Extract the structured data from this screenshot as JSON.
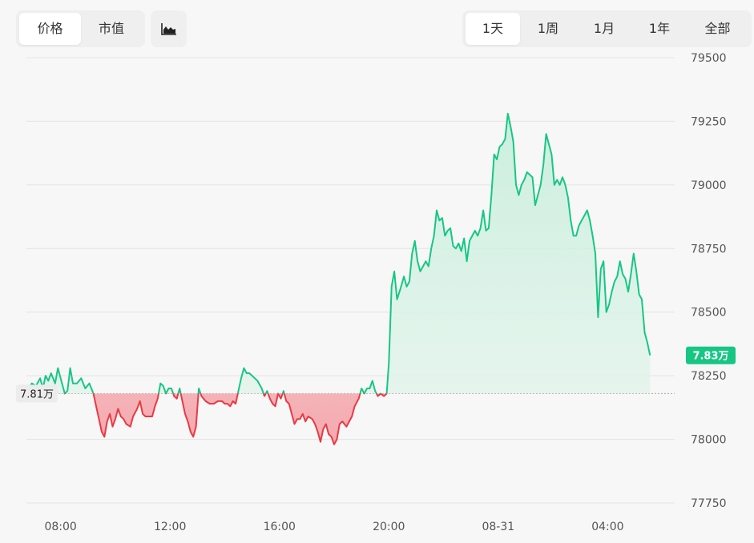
{
  "toolbar": {
    "metric_tabs": [
      {
        "label": "价格",
        "active": true
      },
      {
        "label": "市值",
        "active": false
      }
    ],
    "chart_type_icon": "area-chart-icon",
    "range_tabs": [
      {
        "label": "1天",
        "active": true
      },
      {
        "label": "1周",
        "active": false
      },
      {
        "label": "1月",
        "active": false
      },
      {
        "label": "1年",
        "active": false
      },
      {
        "label": "全部",
        "active": false
      }
    ]
  },
  "colors": {
    "up": "#16c784",
    "down": "#ea3943",
    "up_fill": "#d7f2e5",
    "down_fill": "#f6b9bd",
    "grid": "#e4e4e4"
  },
  "chart_data": {
    "type": "area",
    "y_ticks": [
      79500,
      79250,
      79000,
      78750,
      78500,
      78250,
      78000,
      77750
    ],
    "ylim": [
      77750,
      79500
    ],
    "x_ticks": [
      {
        "label": "08:00",
        "hour": 8
      },
      {
        "label": "12:00",
        "hour": 12
      },
      {
        "label": "16:00",
        "hour": 16
      },
      {
        "label": "20:00",
        "hour": 20
      },
      {
        "label": "08-31",
        "hour": 24
      },
      {
        "label": "04:00",
        "hour": 28
      }
    ],
    "xlim_hours": [
      6.75,
      30.45
    ],
    "baseline": {
      "value": 78180,
      "label": "7.81万"
    },
    "current": {
      "value": 78330,
      "label": "7.83万"
    },
    "series": [
      {
        "values": [
          [
            6.82,
            78200
          ],
          [
            6.95,
            78220
          ],
          [
            7.1,
            78210
          ],
          [
            7.25,
            78240
          ],
          [
            7.35,
            78200
          ],
          [
            7.45,
            78250
          ],
          [
            7.55,
            78230
          ],
          [
            7.65,
            78260
          ],
          [
            7.8,
            78220
          ],
          [
            7.9,
            78280
          ],
          [
            8.05,
            78220
          ],
          [
            8.15,
            78180
          ],
          [
            8.25,
            78190
          ],
          [
            8.35,
            78280
          ],
          [
            8.45,
            78220
          ],
          [
            8.6,
            78220
          ],
          [
            8.75,
            78240
          ],
          [
            8.9,
            78200
          ],
          [
            9.05,
            78220
          ],
          [
            9.2,
            78180
          ],
          [
            9.3,
            78130
          ],
          [
            9.4,
            78080
          ],
          [
            9.5,
            78030
          ],
          [
            9.6,
            78010
          ],
          [
            9.7,
            78070
          ],
          [
            9.8,
            78100
          ],
          [
            9.9,
            78050
          ],
          [
            10.0,
            78080
          ],
          [
            10.1,
            78120
          ],
          [
            10.2,
            78090
          ],
          [
            10.3,
            78080
          ],
          [
            10.4,
            78060
          ],
          [
            10.55,
            78050
          ],
          [
            10.65,
            78090
          ],
          [
            10.8,
            78120
          ],
          [
            10.9,
            78150
          ],
          [
            11.0,
            78100
          ],
          [
            11.1,
            78090
          ],
          [
            11.25,
            78090
          ],
          [
            11.35,
            78090
          ],
          [
            11.45,
            78130
          ],
          [
            11.55,
            78160
          ],
          [
            11.65,
            78220
          ],
          [
            11.75,
            78210
          ],
          [
            11.85,
            78180
          ],
          [
            11.95,
            78200
          ],
          [
            12.05,
            78200
          ],
          [
            12.15,
            78170
          ],
          [
            12.25,
            78160
          ],
          [
            12.35,
            78200
          ],
          [
            12.45,
            78150
          ],
          [
            12.55,
            78100
          ],
          [
            12.65,
            78070
          ],
          [
            12.75,
            78030
          ],
          [
            12.85,
            78010
          ],
          [
            12.95,
            78050
          ],
          [
            13.05,
            78200
          ],
          [
            13.15,
            78170
          ],
          [
            13.3,
            78150
          ],
          [
            13.45,
            78140
          ],
          [
            13.6,
            78140
          ],
          [
            13.75,
            78150
          ],
          [
            13.9,
            78150
          ],
          [
            14.0,
            78140
          ],
          [
            14.1,
            78140
          ],
          [
            14.2,
            78130
          ],
          [
            14.3,
            78150
          ],
          [
            14.4,
            78140
          ],
          [
            14.5,
            78190
          ],
          [
            14.6,
            78240
          ],
          [
            14.7,
            78280
          ],
          [
            14.8,
            78260
          ],
          [
            14.9,
            78260
          ],
          [
            15.0,
            78250
          ],
          [
            15.1,
            78240
          ],
          [
            15.2,
            78230
          ],
          [
            15.35,
            78200
          ],
          [
            15.45,
            78170
          ],
          [
            15.55,
            78190
          ],
          [
            15.65,
            78160
          ],
          [
            15.75,
            78140
          ],
          [
            15.85,
            78130
          ],
          [
            15.95,
            78180
          ],
          [
            16.05,
            78160
          ],
          [
            16.15,
            78190
          ],
          [
            16.25,
            78150
          ],
          [
            16.35,
            78140
          ],
          [
            16.45,
            78100
          ],
          [
            16.55,
            78060
          ],
          [
            16.65,
            78080
          ],
          [
            16.75,
            78080
          ],
          [
            16.85,
            78100
          ],
          [
            16.95,
            78070
          ],
          [
            17.05,
            78090
          ],
          [
            17.2,
            78080
          ],
          [
            17.3,
            78060
          ],
          [
            17.4,
            78030
          ],
          [
            17.5,
            77990
          ],
          [
            17.6,
            78040
          ],
          [
            17.7,
            78060
          ],
          [
            17.8,
            78020
          ],
          [
            17.9,
            78010
          ],
          [
            18.0,
            77980
          ],
          [
            18.1,
            78000
          ],
          [
            18.2,
            78060
          ],
          [
            18.3,
            78070
          ],
          [
            18.45,
            78050
          ],
          [
            18.55,
            78070
          ],
          [
            18.65,
            78090
          ],
          [
            18.75,
            78130
          ],
          [
            18.9,
            78160
          ],
          [
            19.0,
            78200
          ],
          [
            19.1,
            78180
          ],
          [
            19.2,
            78200
          ],
          [
            19.3,
            78200
          ],
          [
            19.4,
            78230
          ],
          [
            19.5,
            78190
          ],
          [
            19.6,
            78170
          ],
          [
            19.7,
            78180
          ],
          [
            19.82,
            78170
          ],
          [
            19.92,
            78180
          ],
          [
            20.0,
            78300
          ],
          [
            20.1,
            78600
          ],
          [
            20.2,
            78660
          ],
          [
            20.3,
            78550
          ],
          [
            20.42,
            78590
          ],
          [
            20.55,
            78640
          ],
          [
            20.65,
            78600
          ],
          [
            20.75,
            78620
          ],
          [
            20.85,
            78730
          ],
          [
            20.95,
            78780
          ],
          [
            21.05,
            78700
          ],
          [
            21.15,
            78660
          ],
          [
            21.25,
            78680
          ],
          [
            21.35,
            78700
          ],
          [
            21.45,
            78680
          ],
          [
            21.55,
            78750
          ],
          [
            21.65,
            78800
          ],
          [
            21.75,
            78900
          ],
          [
            21.85,
            78860
          ],
          [
            21.95,
            78870
          ],
          [
            22.05,
            78800
          ],
          [
            22.15,
            78820
          ],
          [
            22.25,
            78830
          ],
          [
            22.35,
            78760
          ],
          [
            22.45,
            78750
          ],
          [
            22.55,
            78770
          ],
          [
            22.65,
            78740
          ],
          [
            22.75,
            78790
          ],
          [
            22.85,
            78700
          ],
          [
            22.95,
            78780
          ],
          [
            23.05,
            78800
          ],
          [
            23.15,
            78820
          ],
          [
            23.25,
            78800
          ],
          [
            23.35,
            78830
          ],
          [
            23.45,
            78900
          ],
          [
            23.55,
            78820
          ],
          [
            23.65,
            78830
          ],
          [
            23.75,
            78960
          ],
          [
            23.85,
            79120
          ],
          [
            23.95,
            79100
          ],
          [
            24.05,
            79150
          ],
          [
            24.15,
            79160
          ],
          [
            24.25,
            79180
          ],
          [
            24.35,
            79280
          ],
          [
            24.45,
            79230
          ],
          [
            24.55,
            79170
          ],
          [
            24.65,
            79000
          ],
          [
            24.75,
            78960
          ],
          [
            24.85,
            79000
          ],
          [
            24.95,
            79020
          ],
          [
            25.05,
            79050
          ],
          [
            25.15,
            79040
          ],
          [
            25.25,
            79030
          ],
          [
            25.35,
            78920
          ],
          [
            25.45,
            78960
          ],
          [
            25.55,
            79000
          ],
          [
            25.65,
            79080
          ],
          [
            25.75,
            79200
          ],
          [
            25.85,
            79160
          ],
          [
            25.95,
            79120
          ],
          [
            26.05,
            79000
          ],
          [
            26.15,
            79020
          ],
          [
            26.25,
            79000
          ],
          [
            26.35,
            79030
          ],
          [
            26.45,
            79000
          ],
          [
            26.55,
            78950
          ],
          [
            26.65,
            78860
          ],
          [
            26.75,
            78800
          ],
          [
            26.85,
            78800
          ],
          [
            26.95,
            78840
          ],
          [
            27.05,
            78860
          ],
          [
            27.15,
            78880
          ],
          [
            27.25,
            78900
          ],
          [
            27.35,
            78860
          ],
          [
            27.45,
            78800
          ],
          [
            27.55,
            78730
          ],
          [
            27.65,
            78480
          ],
          [
            27.75,
            78670
          ],
          [
            27.85,
            78700
          ],
          [
            27.95,
            78500
          ],
          [
            28.05,
            78530
          ],
          [
            28.15,
            78580
          ],
          [
            28.25,
            78620
          ],
          [
            28.35,
            78640
          ],
          [
            28.45,
            78700
          ],
          [
            28.55,
            78650
          ],
          [
            28.65,
            78630
          ],
          [
            28.75,
            78580
          ],
          [
            28.85,
            78650
          ],
          [
            28.95,
            78730
          ],
          [
            29.05,
            78660
          ],
          [
            29.15,
            78570
          ],
          [
            29.25,
            78550
          ],
          [
            29.35,
            78420
          ],
          [
            29.45,
            78380
          ],
          [
            29.55,
            78330
          ]
        ]
      }
    ]
  }
}
